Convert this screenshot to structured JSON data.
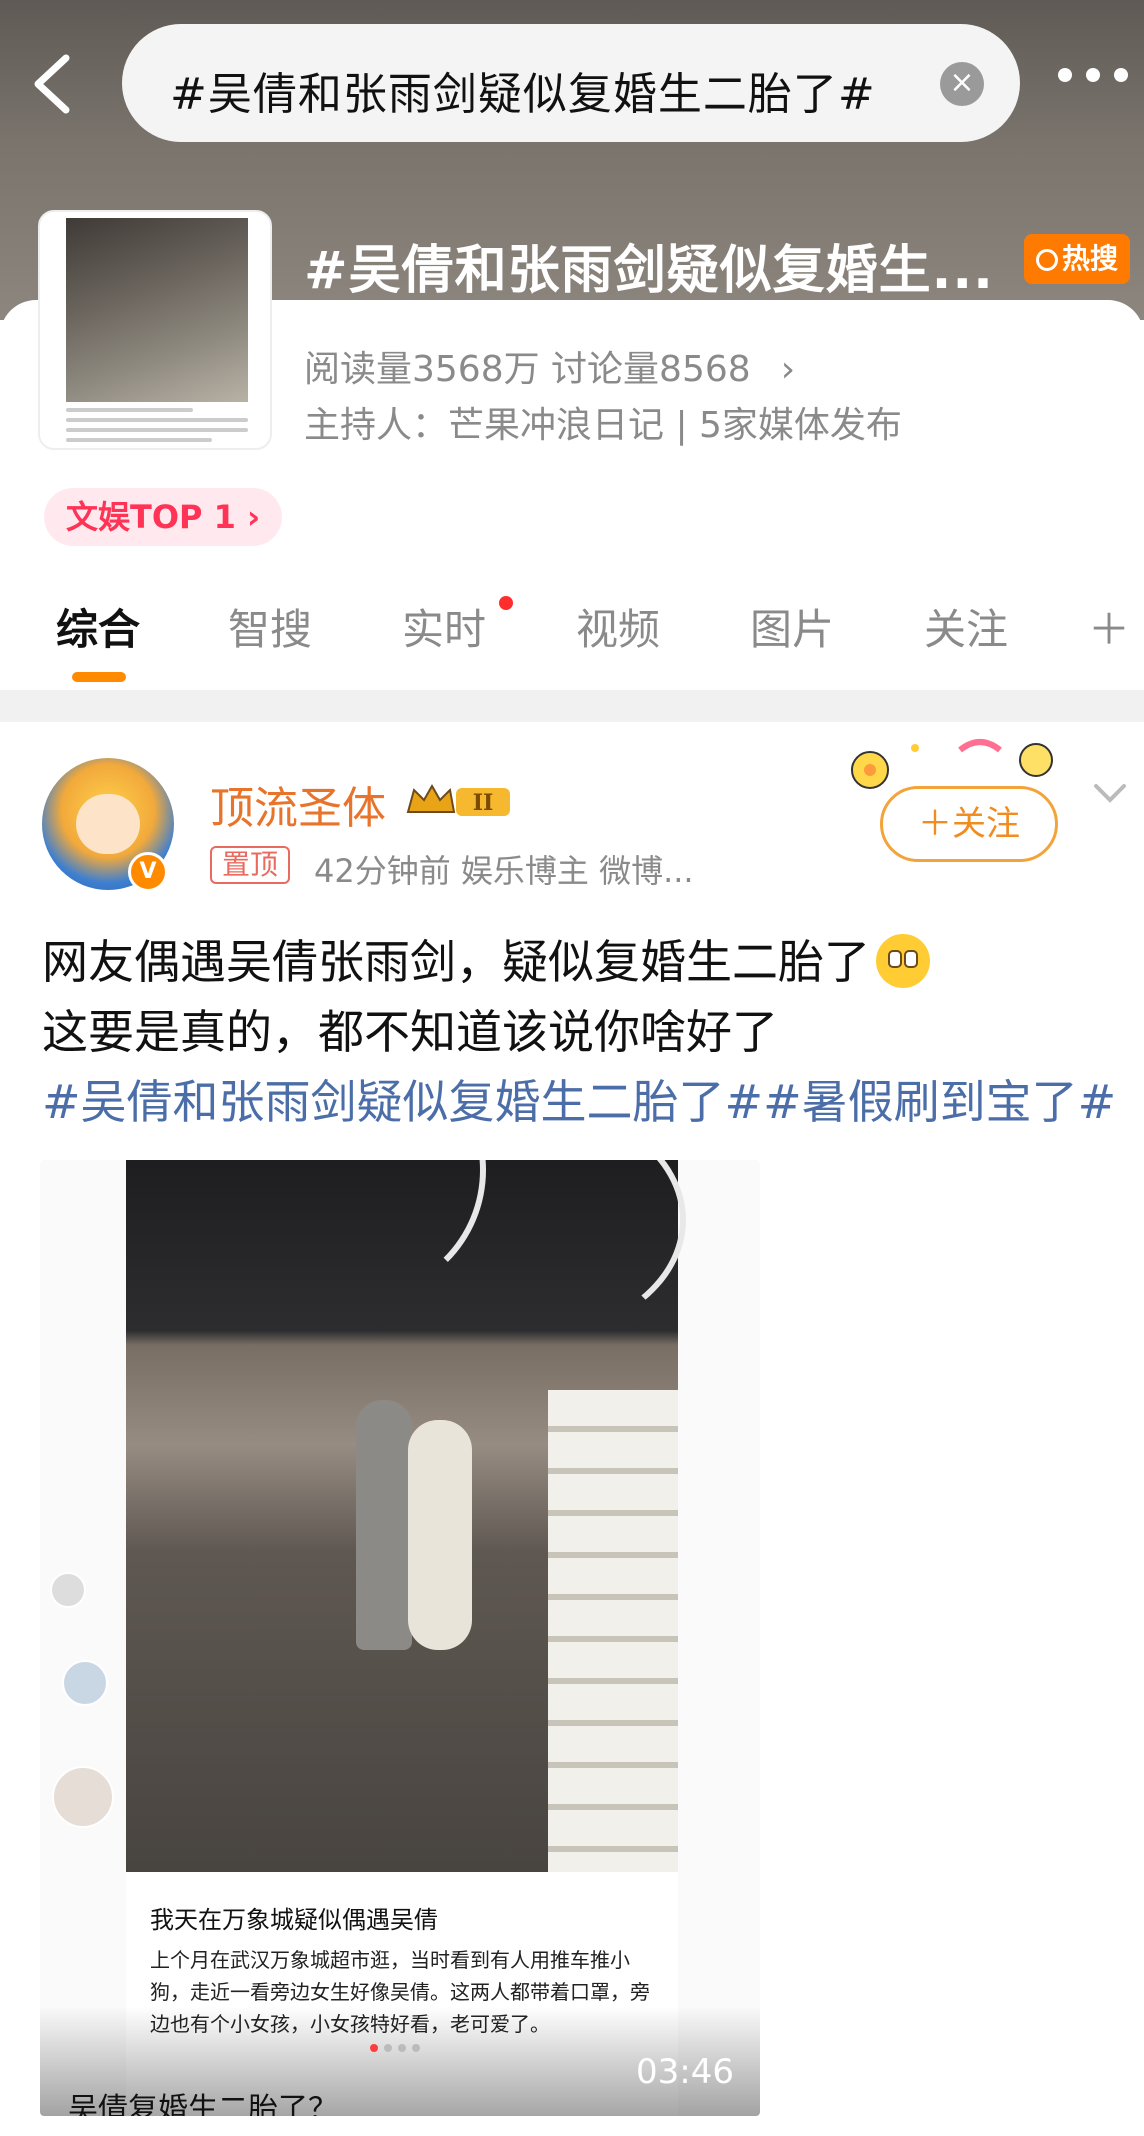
{
  "search": {
    "query": "#吴倩和张雨剑疑似复婚生二胎了#"
  },
  "topic": {
    "title": "#吴倩和张雨剑疑似复婚生...",
    "hot_badge": "热搜",
    "stats": "阅读量3568万  讨论量8568",
    "host": "主持人：芒果冲浪日记 | 5家媒体发布",
    "rank_badge": "文娱TOP 1 ›",
    "thumbnail_caption": "我天在万象城疑似偶遇吴倩"
  },
  "tabs": [
    {
      "label": "综合",
      "active": true
    },
    {
      "label": "智搜"
    },
    {
      "label": "实时",
      "dot": true
    },
    {
      "label": "视频"
    },
    {
      "label": "图片"
    },
    {
      "label": "关注"
    },
    {
      "label": "＋"
    }
  ],
  "post": {
    "username": "顶流圣体",
    "level_badge": "II",
    "pin_label": "置顶",
    "meta": "42分钟前  娱乐博主 微博...",
    "follow_label": "＋关注",
    "text_line1": "网友偶遇吴倩张雨剑，疑似复婚生二胎了",
    "text_line2": "这要是真的，都不知道该说你啥好了",
    "hashtags": "#吴倩和张雨剑疑似复婚生二胎了##暑假刷到宝了#"
  },
  "media": {
    "caption_title": "我天在万象城疑似偶遇吴倩",
    "caption_body": "上个月在武汉万象城超市逛，当时看到有人用推车推小狗，走近一看旁边女生好像吴倩。这两人都带着口罩，旁边也有个小女孩，小女孩特好看，老可爱了。",
    "duration": "03:46",
    "video_title": "吴倩复婚生二胎了？",
    "page_dots": 4,
    "active_dot": 0
  },
  "colors": {
    "accent_orange": "#ff8a00",
    "hashtag_blue": "#4c6ea8",
    "username_orange": "#e8742c",
    "rank_red": "#ff3355"
  }
}
